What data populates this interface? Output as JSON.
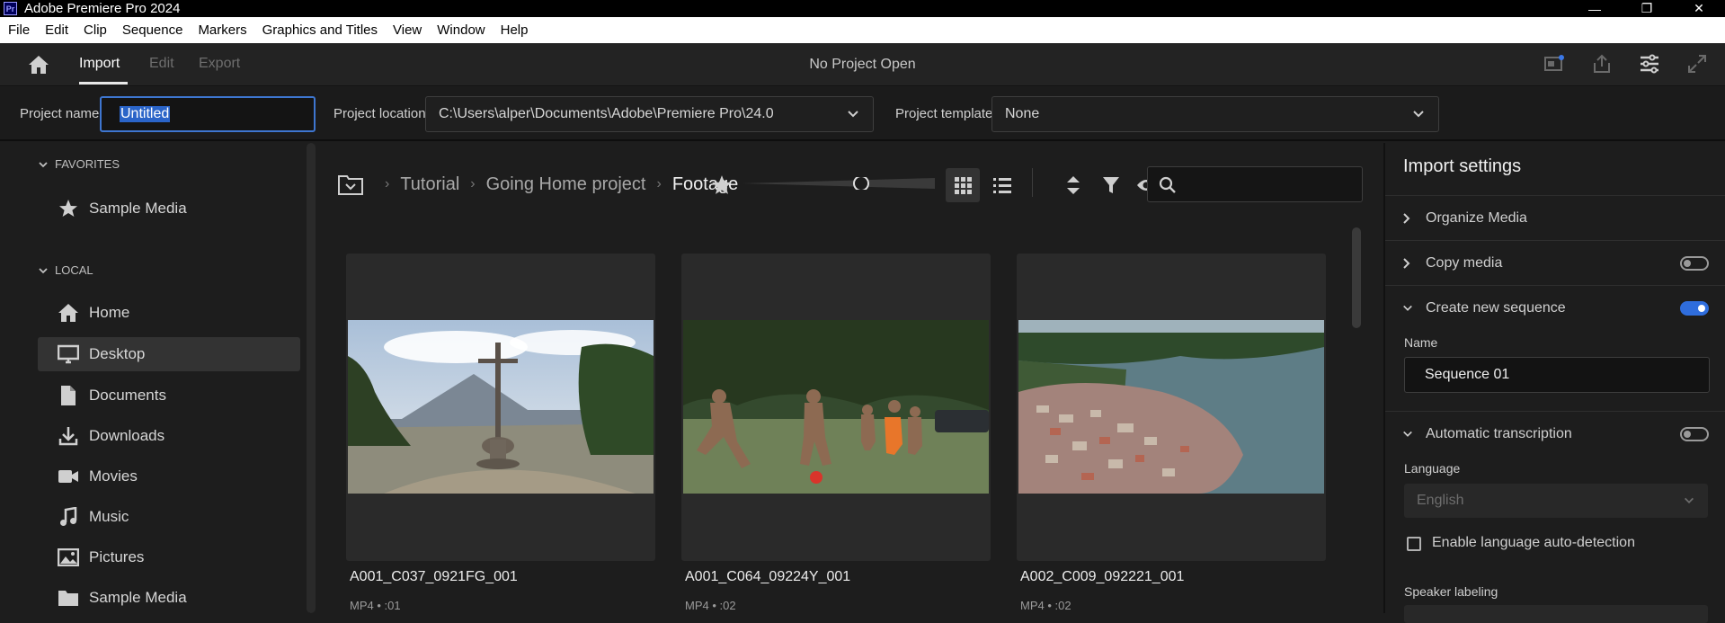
{
  "app": {
    "logo_text": "Pr",
    "title": "Adobe Premiere Pro 2024"
  },
  "window_controls": {
    "minimize": "—",
    "restore": "❐",
    "close": "✕"
  },
  "menu": [
    "File",
    "Edit",
    "Clip",
    "Sequence",
    "Markers",
    "Graphics and Titles",
    "View",
    "Window",
    "Help"
  ],
  "topbar": {
    "tabs": [
      "Import",
      "Edit",
      "Export"
    ],
    "active_tab": "Import",
    "project_title": "No Project Open"
  },
  "project_settings": {
    "name_label": "Project name",
    "name_value": "Untitled",
    "location_label": "Project location",
    "location_value": "C:\\Users\\alper\\Documents\\Adobe\\Premiere Pro\\24.0",
    "template_label": "Project template",
    "template_value": "None"
  },
  "sidebar": {
    "favorites_label": "FAVORITES",
    "favorites": [
      {
        "label": "Sample Media",
        "icon": "star-icon"
      }
    ],
    "local_label": "LOCAL",
    "local": [
      {
        "label": "Home",
        "icon": "home-icon"
      },
      {
        "label": "Desktop",
        "icon": "desktop-icon",
        "selected": true
      },
      {
        "label": "Documents",
        "icon": "document-icon"
      },
      {
        "label": "Downloads",
        "icon": "download-icon"
      },
      {
        "label": "Movies",
        "icon": "movie-icon"
      },
      {
        "label": "Music",
        "icon": "music-icon"
      },
      {
        "label": "Pictures",
        "icon": "picture-icon"
      },
      {
        "label": "Sample Media",
        "icon": "folder-icon"
      }
    ]
  },
  "browser": {
    "breadcrumb": [
      "Tutorial",
      "Going Home project",
      "Footage"
    ],
    "view_mode": "grid",
    "search_placeholder": "",
    "clips": [
      {
        "name": "A001_C037_0921FG_001",
        "meta": "MP4 • :01"
      },
      {
        "name": "A001_C064_09224Y_001",
        "meta": "MP4 • :02"
      },
      {
        "name": "A002_C009_092221_001",
        "meta": "MP4 • :02"
      }
    ]
  },
  "import_settings": {
    "title": "Import settings",
    "organize_media": "Organize Media",
    "copy_media": "Copy media",
    "copy_media_on": false,
    "create_sequence": "Create new sequence",
    "create_sequence_on": true,
    "seq_name_label": "Name",
    "seq_name_value": "Sequence 01",
    "auto_transcription": "Automatic transcription",
    "auto_transcription_on": false,
    "language_label": "Language",
    "language_value": "English",
    "auto_detect_label": "Enable language auto-detection",
    "speaker_label": "Speaker labeling"
  },
  "colors": {
    "accent": "#2f6ddc",
    "selection": "#2a64c8",
    "background": "#1d1d1d"
  }
}
